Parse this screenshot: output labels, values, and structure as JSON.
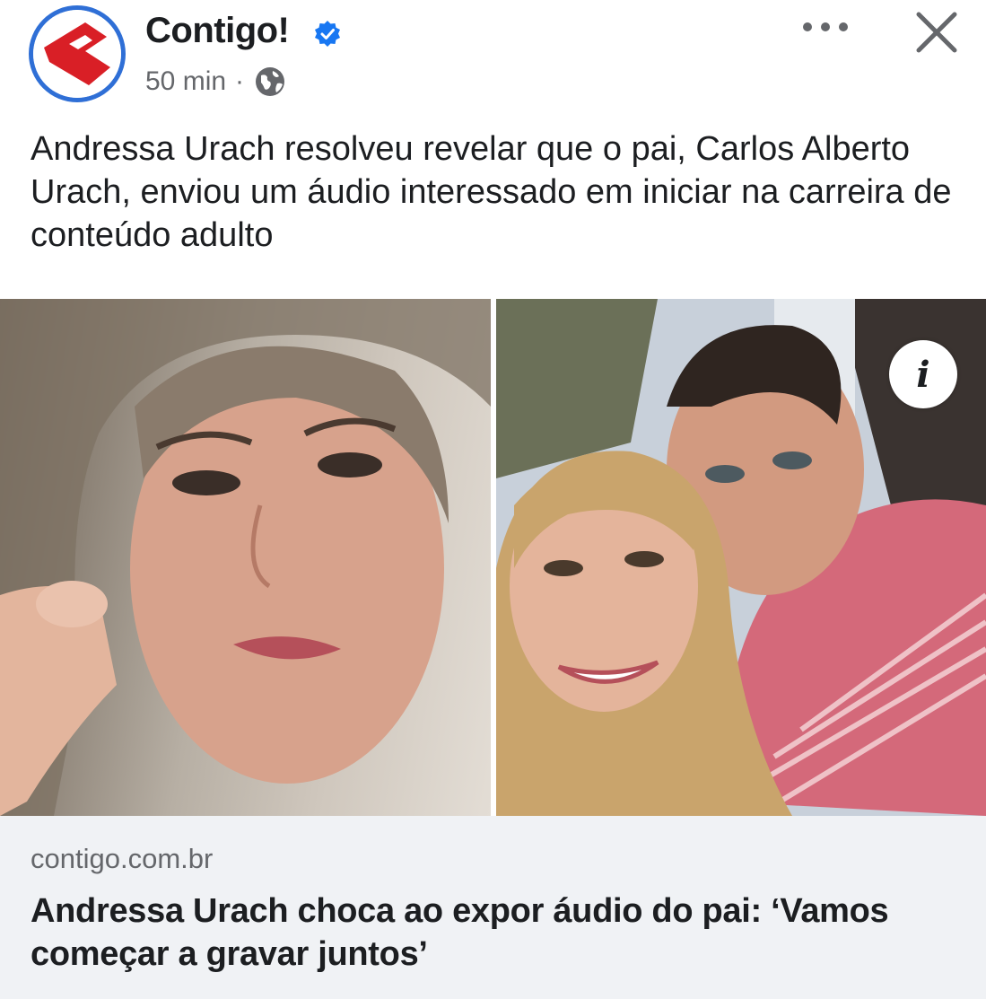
{
  "post": {
    "page_name": "Contigo!",
    "time": "50 min",
    "separator": "·",
    "privacy_icon": "globe-icon",
    "verified_icon": "verified-badge-icon",
    "more_icon": "more-options-icon",
    "close_icon": "close-icon",
    "caption": "Andressa Urach resolveu revelar que o pai, Carlos Alberto Urach, enviou um áudio interessado em iniciar na carreira de conteúdo adulto"
  },
  "link_preview": {
    "domain": "contigo.com.br",
    "title": "Andressa Urach choca ao expor áudio do pai: ‘Vamos começar a gravar juntos’",
    "info_icon": "info-icon",
    "info_glyph": "i"
  },
  "colors": {
    "accent_blue": "#2f6fd6",
    "logo_red": "#d91f26",
    "card_background": "#f0f2f5",
    "muted_text": "#65676b"
  }
}
